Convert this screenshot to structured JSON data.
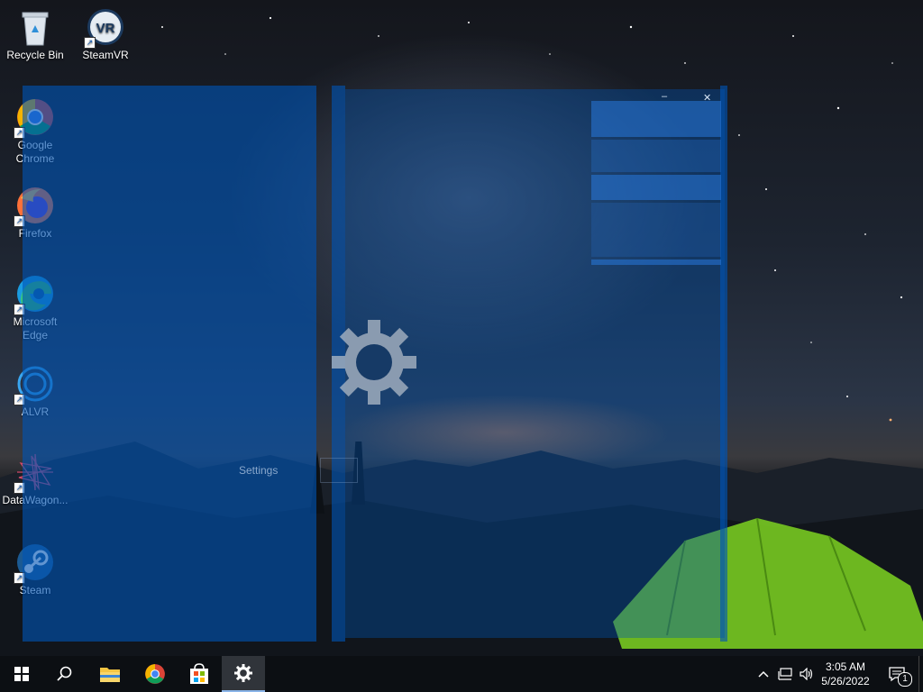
{
  "desktop": {
    "icons": [
      {
        "label": "Recycle Bin"
      },
      {
        "label": "SteamVR",
        "badge": "VR"
      },
      {
        "label": "Google Chrome"
      },
      {
        "label": "Firefox"
      },
      {
        "label": "Microsoft Edge"
      },
      {
        "label": "ALVR"
      },
      {
        "label": "DataWagon..."
      },
      {
        "label": "Steam"
      }
    ]
  },
  "settings_window": {
    "splash_label": "Settings",
    "minimize_glyph": "–",
    "close_glyph": "✕"
  },
  "taskbar": {
    "clock_time": "3:05 AM",
    "clock_date": "5/26/2022",
    "notification_count": "1",
    "pinned": [
      {
        "name": "start-button",
        "icon": "windows-logo-icon"
      },
      {
        "name": "search-button",
        "icon": "search-icon"
      },
      {
        "name": "file-explorer",
        "icon": "folder-icon"
      },
      {
        "name": "chrome",
        "icon": "chrome-icon"
      },
      {
        "name": "microsoft-store",
        "icon": "store-icon"
      },
      {
        "name": "settings",
        "icon": "gear-icon",
        "active": true
      }
    ]
  },
  "colors": {
    "accent_blue": "#0054b4",
    "taskbar": "#0c0f13",
    "tent_green": "#7ed321"
  }
}
